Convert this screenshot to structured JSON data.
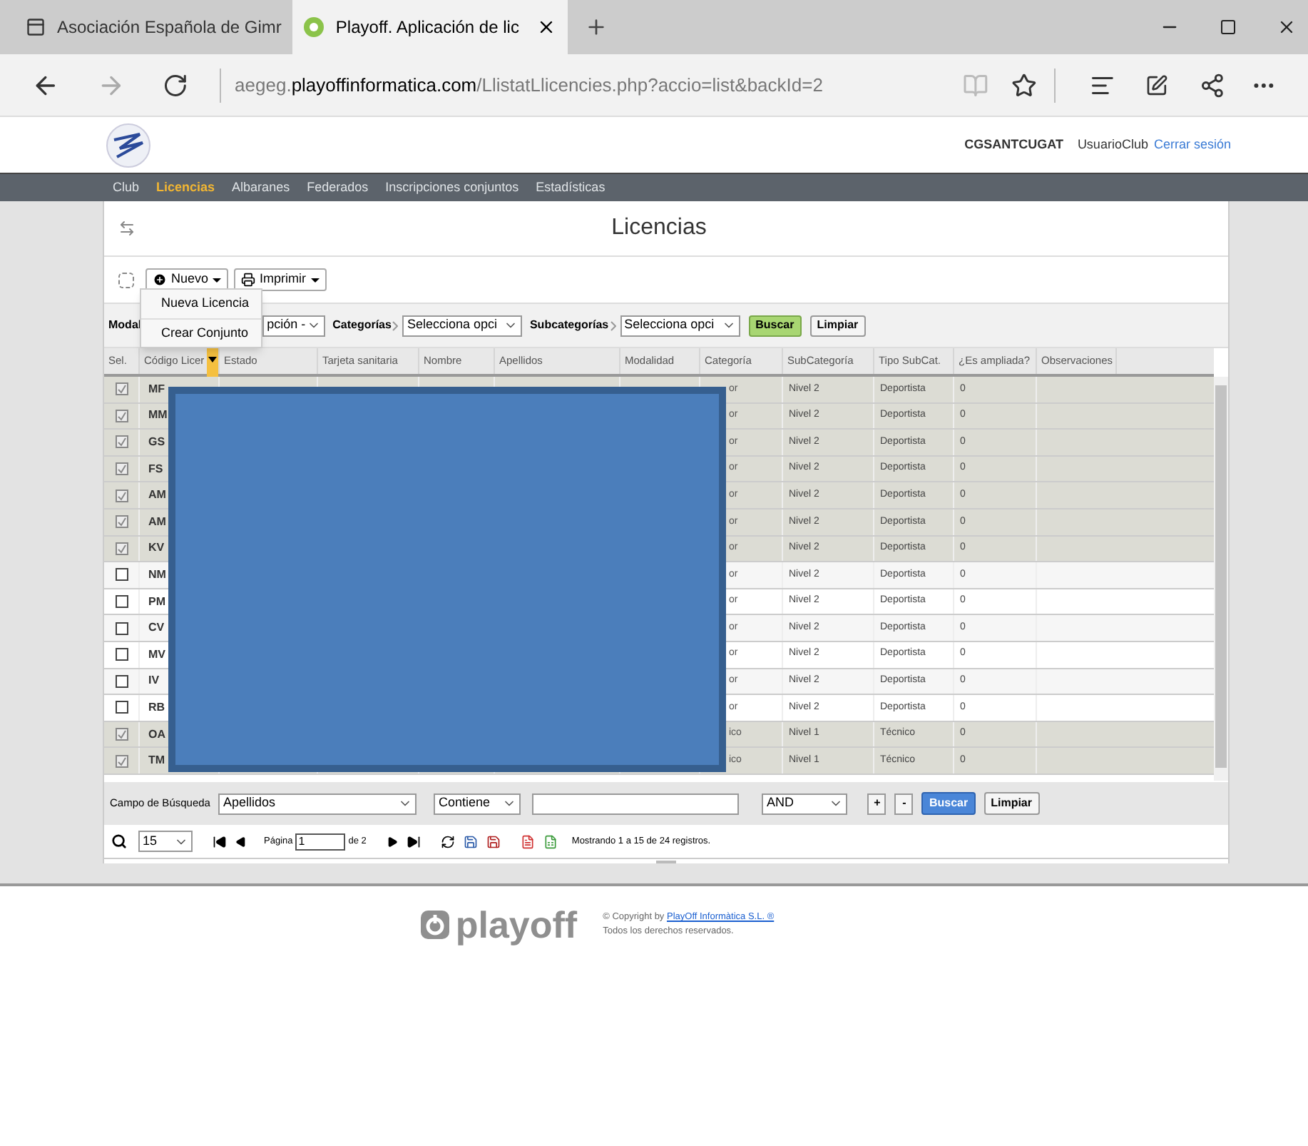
{
  "browser": {
    "tabs": [
      {
        "title": "Asociación Española de Gimr",
        "selected": false
      },
      {
        "title": "Playoff. Aplicación de lic",
        "selected": true
      }
    ],
    "url": {
      "prefix": "aegeg.",
      "domain": "playoffinformatica.com",
      "path": "/LlistatLlicencies.php?accio=list&backId=2"
    }
  },
  "header": {
    "club": "CGSANTCUGAT",
    "user": "UsuarioClub",
    "logout": "Cerrar sesión"
  },
  "nav": [
    {
      "label": "Club",
      "selected": false
    },
    {
      "label": "Licencias",
      "selected": true
    },
    {
      "label": "Albaranes",
      "selected": false
    },
    {
      "label": "Federados",
      "selected": false
    },
    {
      "label": "Inscripciones conjuntos",
      "selected": false
    },
    {
      "label": "Estadísticas",
      "selected": false
    }
  ],
  "title": "Licencias",
  "toolbar": {
    "select_all_checked": false,
    "new": "Nuevo",
    "print": "Imprimir",
    "menu": [
      "Nueva Licencia",
      "Crear Conjunto"
    ]
  },
  "filters": {
    "label_cut": "Modal",
    "select_cut": "pción -",
    "categories_label": "Categorías",
    "categories_value": "Selecciona opci",
    "subcategories_label": "Subcategorías",
    "subcategories_value": "Selecciona opci",
    "search": "Buscar",
    "clear": "Limpiar"
  },
  "table": {
    "columns": [
      {
        "label": "Sel.",
        "sorted": false
      },
      {
        "label": "Código Licer",
        "sorted": true
      },
      {
        "label": "Estado",
        "sorted": false
      },
      {
        "label": "Tarjeta sanitaria",
        "sorted": false
      },
      {
        "label": "Nombre",
        "sorted": false
      },
      {
        "label": "Apellidos",
        "sorted": false
      },
      {
        "label": "Modalidad",
        "sorted": false
      },
      {
        "label": "Categoría",
        "sorted": false
      },
      {
        "label": "SubCategoría",
        "sorted": false
      },
      {
        "label": "Tipo SubCat.",
        "sorted": false
      },
      {
        "label": "¿Es ampliada?",
        "sorted": false
      },
      {
        "label": "Observaciones",
        "sorted": false
      }
    ],
    "rows": [
      {
        "checked": true,
        "code": "MF",
        "category": "or",
        "subcategory": "Nivel 2",
        "type": "Deportista",
        "extended": "0"
      },
      {
        "checked": true,
        "code": "MM",
        "category": "or",
        "subcategory": "Nivel 2",
        "type": "Deportista",
        "extended": "0"
      },
      {
        "checked": true,
        "code": "GS",
        "category": "or",
        "subcategory": "Nivel 2",
        "type": "Deportista",
        "extended": "0"
      },
      {
        "checked": true,
        "code": "FS",
        "category": "or",
        "subcategory": "Nivel 2",
        "type": "Deportista",
        "extended": "0"
      },
      {
        "checked": true,
        "code": "AM",
        "category": "or",
        "subcategory": "Nivel 2",
        "type": "Deportista",
        "extended": "0"
      },
      {
        "checked": true,
        "code": "AM",
        "category": "or",
        "subcategory": "Nivel 2",
        "type": "Deportista",
        "extended": "0"
      },
      {
        "checked": true,
        "code": "KV",
        "category": "or",
        "subcategory": "Nivel 2",
        "type": "Deportista",
        "extended": "0"
      },
      {
        "checked": false,
        "code": "NM",
        "category": "or",
        "subcategory": "Nivel 2",
        "type": "Deportista",
        "extended": "0"
      },
      {
        "checked": false,
        "code": "PM",
        "category": "or",
        "subcategory": "Nivel 2",
        "type": "Deportista",
        "extended": "0"
      },
      {
        "checked": false,
        "code": "CV",
        "category": "or",
        "subcategory": "Nivel 2",
        "type": "Deportista",
        "extended": "0"
      },
      {
        "checked": false,
        "code": "MV",
        "category": "or",
        "subcategory": "Nivel 2",
        "type": "Deportista",
        "extended": "0"
      },
      {
        "checked": false,
        "code": "IV",
        "category": "or",
        "subcategory": "Nivel 2",
        "type": "Deportista",
        "extended": "0"
      },
      {
        "checked": false,
        "code": "RB",
        "category": "or",
        "subcategory": "Nivel 2",
        "type": "Deportista",
        "extended": "0"
      },
      {
        "checked": true,
        "code": "OA",
        "category": "ico",
        "subcategory": "Nivel 1",
        "type": "Técnico",
        "extended": "0"
      },
      {
        "checked": true,
        "code": "TM",
        "category": "ico",
        "subcategory": "Nivel 1",
        "type": "Técnico",
        "extended": "0"
      }
    ]
  },
  "search": {
    "label": "Campo de Búsqueda",
    "field": "Apellidos",
    "operator": "Contiene",
    "logic": "AND",
    "add": "+",
    "remove": "-",
    "search": "Buscar",
    "clear": "Limpiar"
  },
  "pager": {
    "page_size": "15",
    "page_label": "Página",
    "page": "1",
    "of": "de 2",
    "status": "Mostrando 1 a 15 de 24 registros."
  },
  "footer": {
    "logo": "playoff",
    "copyright": "© Copyright by",
    "company": "PlayOff Informàtica S.L. ®",
    "rights": "Todos los derechos reservados."
  }
}
